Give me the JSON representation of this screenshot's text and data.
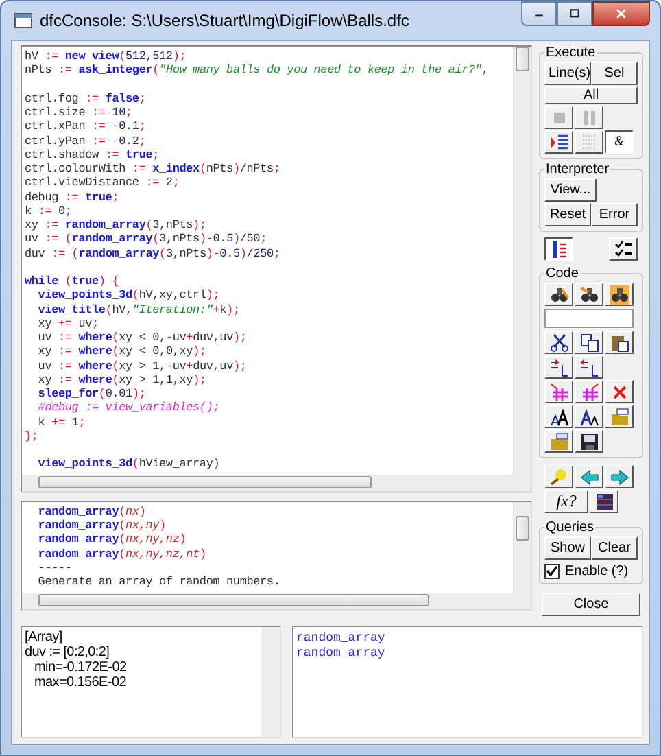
{
  "window": {
    "title": "dfcConsole: S:\\Users\\Stuart\\Img\\DigiFlow\\Balls.dfc"
  },
  "editor": {
    "blocks": [
      [
        [
          {
            "kind": "plain",
            "text": "hV "
          },
          {
            "kind": "op",
            "text": ":= "
          },
          {
            "kind": "func",
            "text": "new_view"
          },
          {
            "kind": "op",
            "text": "("
          },
          {
            "kind": "num",
            "text": "512,512"
          },
          {
            "kind": "op",
            "text": ");"
          }
        ],
        [
          {
            "kind": "plain",
            "text": "nPts "
          },
          {
            "kind": "op",
            "text": ":= "
          },
          {
            "kind": "func",
            "text": "ask_integer"
          },
          {
            "kind": "op",
            "text": "("
          },
          {
            "kind": "str",
            "text": "\"How many balls do you need to keep in the air?\""
          },
          {
            "kind": "op",
            "text": ","
          }
        ]
      ],
      [
        [
          {
            "kind": "plain",
            "text": "ctrl.fog "
          },
          {
            "kind": "op",
            "text": ":= "
          },
          {
            "kind": "kw",
            "text": "false"
          },
          {
            "kind": "op",
            "text": ";"
          }
        ],
        [
          {
            "kind": "plain",
            "text": "ctrl.size "
          },
          {
            "kind": "op",
            "text": ":= "
          },
          {
            "kind": "num",
            "text": "10"
          },
          {
            "kind": "op",
            "text": ";"
          }
        ],
        [
          {
            "kind": "plain",
            "text": "ctrl.xPan "
          },
          {
            "kind": "op",
            "text": ":= "
          },
          {
            "kind": "num",
            "text": "-0.1"
          },
          {
            "kind": "op",
            "text": ";"
          }
        ],
        [
          {
            "kind": "plain",
            "text": "ctrl.yPan "
          },
          {
            "kind": "op",
            "text": ":= "
          },
          {
            "kind": "num",
            "text": "-0.2"
          },
          {
            "kind": "op",
            "text": ";"
          }
        ],
        [
          {
            "kind": "plain",
            "text": "ctrl.shadow "
          },
          {
            "kind": "op",
            "text": ":= "
          },
          {
            "kind": "kw",
            "text": "true"
          },
          {
            "kind": "op",
            "text": ";"
          }
        ],
        [
          {
            "kind": "plain",
            "text": "ctrl.colourWith "
          },
          {
            "kind": "op",
            "text": ":= "
          },
          {
            "kind": "func",
            "text": "x_index"
          },
          {
            "kind": "op",
            "text": "("
          },
          {
            "kind": "plain",
            "text": "nPts"
          },
          {
            "kind": "op",
            "text": ")"
          },
          {
            "kind": "plain",
            "text": "/nPts"
          },
          {
            "kind": "op",
            "text": ";"
          }
        ],
        [
          {
            "kind": "plain",
            "text": "ctrl.viewDistance "
          },
          {
            "kind": "op",
            "text": ":= "
          },
          {
            "kind": "num",
            "text": "2"
          },
          {
            "kind": "op",
            "text": ";"
          }
        ],
        [
          {
            "kind": "plain",
            "text": "debug "
          },
          {
            "kind": "op",
            "text": ":= "
          },
          {
            "kind": "kw",
            "text": "true"
          },
          {
            "kind": "op",
            "text": ";"
          }
        ],
        [
          {
            "kind": "plain",
            "text": "k "
          },
          {
            "kind": "op",
            "text": ":= "
          },
          {
            "kind": "num",
            "text": "0"
          },
          {
            "kind": "op",
            "text": ";"
          }
        ],
        [
          {
            "kind": "plain",
            "text": "xy "
          },
          {
            "kind": "op",
            "text": ":= "
          },
          {
            "kind": "func",
            "text": "random_array"
          },
          {
            "kind": "op",
            "text": "("
          },
          {
            "kind": "num",
            "text": "3"
          },
          {
            "kind": "plain",
            "text": ",nPts"
          },
          {
            "kind": "op",
            "text": ");"
          }
        ],
        [
          {
            "kind": "plain",
            "text": "uv "
          },
          {
            "kind": "op",
            "text": ":= ("
          },
          {
            "kind": "func",
            "text": "random_array"
          },
          {
            "kind": "op",
            "text": "("
          },
          {
            "kind": "num",
            "text": "3"
          },
          {
            "kind": "plain",
            "text": ",nPts"
          },
          {
            "kind": "op",
            "text": ")-"
          },
          {
            "kind": "num",
            "text": "0.5"
          },
          {
            "kind": "op",
            "text": ")"
          },
          {
            "kind": "plain",
            "text": "/"
          },
          {
            "kind": "num",
            "text": "50"
          },
          {
            "kind": "op",
            "text": ";"
          }
        ],
        [
          {
            "kind": "plain",
            "text": "duv "
          },
          {
            "kind": "op",
            "text": ":= ("
          },
          {
            "kind": "func",
            "text": "random_array"
          },
          {
            "kind": "op",
            "text": "("
          },
          {
            "kind": "num",
            "text": "3"
          },
          {
            "kind": "plain",
            "text": ",nPts"
          },
          {
            "kind": "op",
            "text": ")-"
          },
          {
            "kind": "num",
            "text": "0.5"
          },
          {
            "kind": "op",
            "text": ")"
          },
          {
            "kind": "plain",
            "text": "/"
          },
          {
            "kind": "num",
            "text": "250"
          },
          {
            "kind": "op",
            "text": ";"
          }
        ]
      ],
      [
        [
          {
            "kind": "kw",
            "text": "while "
          },
          {
            "kind": "op",
            "text": "("
          },
          {
            "kind": "kw",
            "text": "true"
          },
          {
            "kind": "op",
            "text": ") {"
          }
        ],
        [
          {
            "kind": "func",
            "text": "  view_points_3d"
          },
          {
            "kind": "op",
            "text": "("
          },
          {
            "kind": "plain",
            "text": "hV,xy,ctrl"
          },
          {
            "kind": "op",
            "text": ");"
          }
        ],
        [
          {
            "kind": "func",
            "text": "  view_title"
          },
          {
            "kind": "op",
            "text": "("
          },
          {
            "kind": "plain",
            "text": "hV,"
          },
          {
            "kind": "str",
            "text": "\"Iteration:\""
          },
          {
            "kind": "op",
            "text": "+"
          },
          {
            "kind": "plain",
            "text": "k"
          },
          {
            "kind": "op",
            "text": ");"
          }
        ],
        [
          {
            "kind": "plain",
            "text": "  xy "
          },
          {
            "kind": "op",
            "text": "+= "
          },
          {
            "kind": "plain",
            "text": "uv"
          },
          {
            "kind": "op",
            "text": ";"
          }
        ],
        [
          {
            "kind": "plain",
            "text": "  uv "
          },
          {
            "kind": "op",
            "text": ":= "
          },
          {
            "kind": "func",
            "text": "where"
          },
          {
            "kind": "op",
            "text": "("
          },
          {
            "kind": "plain",
            "text": "xy < 0,"
          },
          {
            "kind": "op",
            "text": "-"
          },
          {
            "kind": "plain",
            "text": "uv"
          },
          {
            "kind": "op",
            "text": "+"
          },
          {
            "kind": "plain",
            "text": "duv,uv"
          },
          {
            "kind": "op",
            "text": ");"
          }
        ],
        [
          {
            "kind": "plain",
            "text": "  xy "
          },
          {
            "kind": "op",
            "text": ":= "
          },
          {
            "kind": "func",
            "text": "where"
          },
          {
            "kind": "op",
            "text": "("
          },
          {
            "kind": "plain",
            "text": "xy < 0,0,xy"
          },
          {
            "kind": "op",
            "text": ");"
          }
        ],
        [
          {
            "kind": "plain",
            "text": "  uv "
          },
          {
            "kind": "op",
            "text": ":= "
          },
          {
            "kind": "func",
            "text": "where"
          },
          {
            "kind": "op",
            "text": "("
          },
          {
            "kind": "plain",
            "text": "xy > 1,"
          },
          {
            "kind": "op",
            "text": "-"
          },
          {
            "kind": "plain",
            "text": "uv"
          },
          {
            "kind": "op",
            "text": "+"
          },
          {
            "kind": "plain",
            "text": "duv,uv"
          },
          {
            "kind": "op",
            "text": ");"
          }
        ],
        [
          {
            "kind": "plain",
            "text": "  xy "
          },
          {
            "kind": "op",
            "text": ":= "
          },
          {
            "kind": "func",
            "text": "where"
          },
          {
            "kind": "op",
            "text": "("
          },
          {
            "kind": "plain",
            "text": "xy > 1,1,xy"
          },
          {
            "kind": "op",
            "text": ");"
          }
        ],
        [
          {
            "kind": "func",
            "text": "  sleep_for"
          },
          {
            "kind": "op",
            "text": "("
          },
          {
            "kind": "num",
            "text": "0.01"
          },
          {
            "kind": "op",
            "text": ");"
          }
        ],
        [
          {
            "kind": "comment",
            "text": "  #debug := view_variables();"
          }
        ],
        [
          {
            "kind": "plain",
            "text": "  k "
          },
          {
            "kind": "op",
            "text": "+= "
          },
          {
            "kind": "num",
            "text": "1"
          },
          {
            "kind": "op",
            "text": ";"
          }
        ],
        [
          {
            "kind": "op",
            "text": "};"
          }
        ]
      ],
      [
        [
          {
            "kind": "func",
            "text": "  view_points_3d"
          },
          {
            "kind": "op",
            "text": "("
          },
          {
            "kind": "plain",
            "text": "hView_array"
          },
          {
            "kind": "op",
            "text": ")"
          }
        ]
      ]
    ]
  },
  "help": {
    "lines": [
      [
        {
          "kind": "func",
          "text": "  random_array"
        },
        {
          "kind": "op",
          "text": "("
        },
        {
          "kind": "arg",
          "text": "nx"
        },
        {
          "kind": "op",
          "text": ")"
        }
      ],
      [
        {
          "kind": "func",
          "text": "  random_array"
        },
        {
          "kind": "op",
          "text": "("
        },
        {
          "kind": "arg",
          "text": "nx,ny"
        },
        {
          "kind": "op",
          "text": ")"
        }
      ],
      [
        {
          "kind": "func",
          "text": "  random_array"
        },
        {
          "kind": "op",
          "text": "("
        },
        {
          "kind": "arg",
          "text": "nx,ny,nz"
        },
        {
          "kind": "op",
          "text": ")"
        }
      ],
      [
        {
          "kind": "func",
          "text": "  random_array"
        },
        {
          "kind": "op",
          "text": "("
        },
        {
          "kind": "arg",
          "text": "nx,ny,nz,nt"
        },
        {
          "kind": "op",
          "text": ")"
        }
      ],
      [
        {
          "kind": "plain",
          "text": "  -----"
        }
      ],
      [
        {
          "kind": "plain",
          "text": "  Generate an array of random numbers."
        }
      ]
    ]
  },
  "execute": {
    "title": "Execute",
    "buttons": [
      "Line(s)",
      "Sel",
      "All"
    ],
    "tools": [
      {
        "kind": "stop",
        "disabled": true
      },
      {
        "kind": "pause",
        "disabled": true
      },
      {
        "kind": "trace",
        "disabled": false
      },
      {
        "kind": "list",
        "disabled": true
      },
      {
        "kind": "toggle",
        "label": "&",
        "disabled": false
      }
    ]
  },
  "interpreter": {
    "title": "Interpreter",
    "buttons": [
      "View...",
      "Reset",
      "Error"
    ]
  },
  "options": [
    {
      "kind": "listing"
    },
    {
      "kind": "checks"
    }
  ],
  "code": {
    "title": "Code",
    "rows": [
      [
        {
          "kind": "find"
        },
        {
          "kind": "find-next"
        },
        {
          "kind": "find-replace"
        }
      ],
      [
        {
          "kind": "field"
        }
      ],
      [
        {
          "kind": "cut"
        },
        {
          "kind": "copy"
        },
        {
          "kind": "paste"
        }
      ],
      [
        {
          "kind": "indent"
        },
        {
          "kind": "outdent"
        }
      ],
      [
        {
          "kind": "comment"
        },
        {
          "kind": "uncomment"
        },
        {
          "kind": "delete"
        }
      ],
      [
        {
          "kind": "font-larger"
        },
        {
          "kind": "font-smaller"
        },
        {
          "kind": "open-last"
        }
      ],
      [
        {
          "kind": "open"
        },
        {
          "kind": "save"
        }
      ]
    ]
  },
  "navigation": [
    [
      {
        "kind": "bulb"
      },
      {
        "kind": "back"
      },
      {
        "kind": "forward"
      }
    ],
    [
      {
        "kind": "label",
        "label": "fx?"
      },
      {
        "kind": "variables"
      }
    ]
  ],
  "queries": {
    "title": "Queries",
    "buttons": [
      "Show",
      "Clear"
    ],
    "checkbox": {
      "label": "Enable (?)",
      "checked": true
    }
  },
  "close_button": "Close",
  "variables": [
    {
      "text": "[Array]"
    },
    {
      "text": "duv := [0:2,0:2]",
      "children": [
        {
          "text": "min=-0.172E-02"
        },
        {
          "text": "max=0.156E-02"
        }
      ]
    }
  ],
  "matches": [
    "random_array",
    "random_array"
  ]
}
